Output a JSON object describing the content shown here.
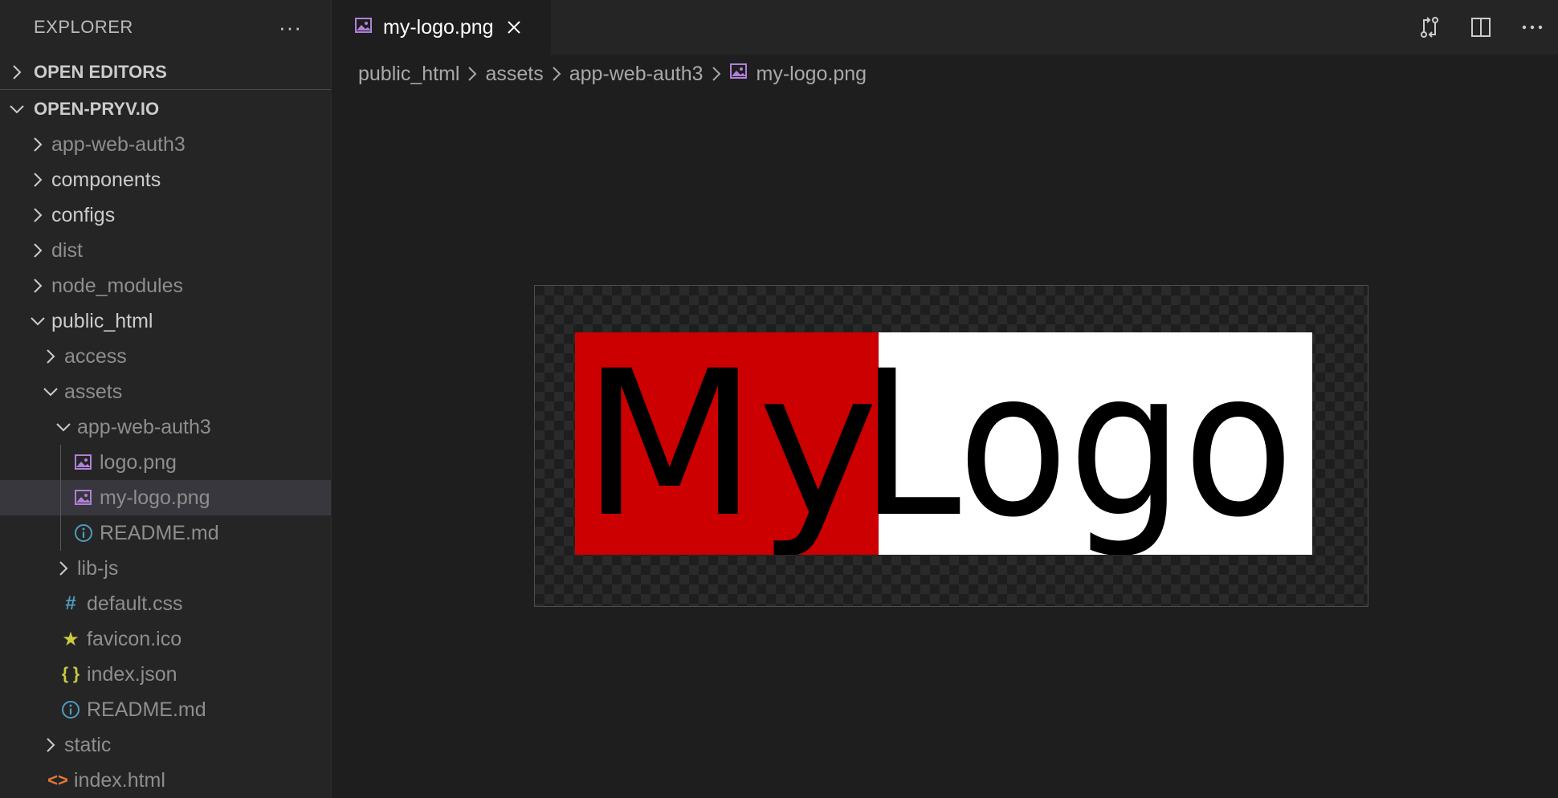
{
  "sidebar": {
    "title": "EXPLORER",
    "more": "···",
    "open_editors": "OPEN EDITORS",
    "project": "OPEN-PRYV.IO",
    "items": [
      {
        "label": "app-web-auth3",
        "kind": "folder",
        "open": false,
        "dim": true
      },
      {
        "label": "components",
        "kind": "folder",
        "open": false,
        "dim": false
      },
      {
        "label": "configs",
        "kind": "folder",
        "open": false,
        "dim": false
      },
      {
        "label": "dist",
        "kind": "folder",
        "open": false,
        "dim": true
      },
      {
        "label": "node_modules",
        "kind": "folder",
        "open": false,
        "dim": true
      },
      {
        "label": "public_html",
        "kind": "folder",
        "open": true,
        "dim": false
      },
      {
        "label": "access",
        "kind": "folder",
        "open": false,
        "dim": true
      },
      {
        "label": "assets",
        "kind": "folder",
        "open": true,
        "dim": true
      },
      {
        "label": "app-web-auth3",
        "kind": "folder",
        "open": true,
        "dim": true
      },
      {
        "label": "logo.png",
        "kind": "image-file",
        "dim": true
      },
      {
        "label": "my-logo.png",
        "kind": "image-file",
        "dim": true,
        "selected": true
      },
      {
        "label": "README.md",
        "kind": "info-file",
        "dim": true
      },
      {
        "label": "lib-js",
        "kind": "folder",
        "open": false,
        "dim": true
      },
      {
        "label": "default.css",
        "kind": "css-file",
        "icon_text": "#",
        "dim": true
      },
      {
        "label": "favicon.ico",
        "kind": "favicon-file",
        "icon_text": "★",
        "dim": true
      },
      {
        "label": "index.json",
        "kind": "json-file",
        "icon_text": "{ }",
        "dim": true
      },
      {
        "label": "README.md",
        "kind": "info-file",
        "dim": true
      },
      {
        "label": "static",
        "kind": "folder",
        "open": false,
        "dim": true
      },
      {
        "label": "index.html",
        "kind": "html-file",
        "icon_text": "<>",
        "dim": true
      }
    ]
  },
  "editor": {
    "tab_label": "my-logo.png",
    "breadcrumb": [
      "public_html",
      "assets",
      "app-web-auth3",
      "my-logo.png"
    ],
    "actions": [
      "open-changes-icon",
      "split-editor-icon",
      "more-actions-icon"
    ],
    "image": {
      "text_part1": "My",
      "text_part2": "Logo",
      "color_left_bg": "#cc0000",
      "color_right_bg": "#ffffff",
      "text_color": "#000000"
    }
  },
  "colors": {
    "accent_icon_image": "#b180d7",
    "info_icon": "#519aba",
    "selected_row": "#37373d"
  }
}
